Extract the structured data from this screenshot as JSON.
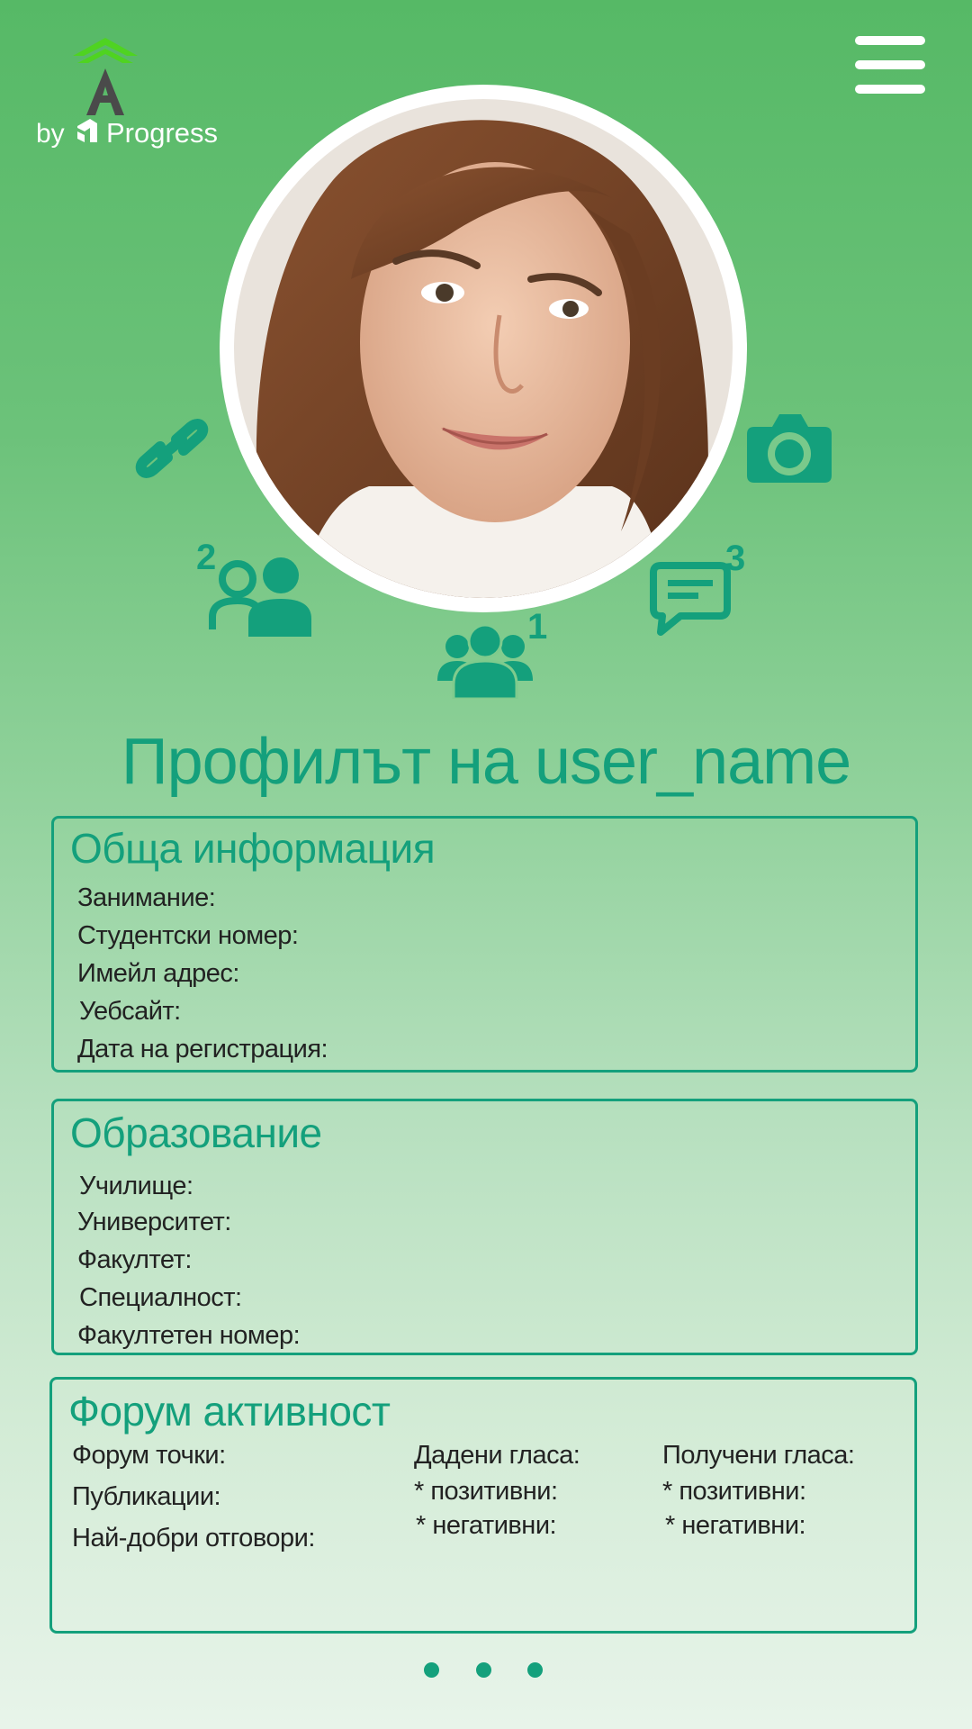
{
  "logo": {
    "by": "by",
    "brand": "Progress"
  },
  "profile": {
    "title": "Профилът на user_name"
  },
  "badges": {
    "friends": "2",
    "groups": "1",
    "messages": "3"
  },
  "general": {
    "heading": "Обща информация",
    "rows": [
      "Занимание:",
      "Студентски номер:",
      "Имейл адрес:",
      "Уебсайт:",
      "Дата на регистрация:"
    ]
  },
  "education": {
    "heading": "Образование",
    "rows": [
      "Училище:",
      "Университет:",
      "Факултет:",
      "Специалност:",
      "Факултетен номер:"
    ]
  },
  "forum": {
    "heading": "Форум активност",
    "col1": [
      "Форум точки:",
      "Публикации:",
      "Най-добри отговори:"
    ],
    "col2": [
      "Дадени гласа:",
      "* позитивни:",
      "* негативни:"
    ],
    "col3": [
      "Получени гласа:",
      "* позитивни:",
      "* негативни:"
    ]
  },
  "pagination": {
    "pages": 3
  },
  "colors": {
    "accent": "#14a07c",
    "bg_top": "#56b966",
    "bg_bottom": "#e8f4ea"
  },
  "icons": [
    "logo-icon",
    "menu-icon",
    "link-icon",
    "camera-icon",
    "friends-icon",
    "groups-icon",
    "messages-icon"
  ]
}
